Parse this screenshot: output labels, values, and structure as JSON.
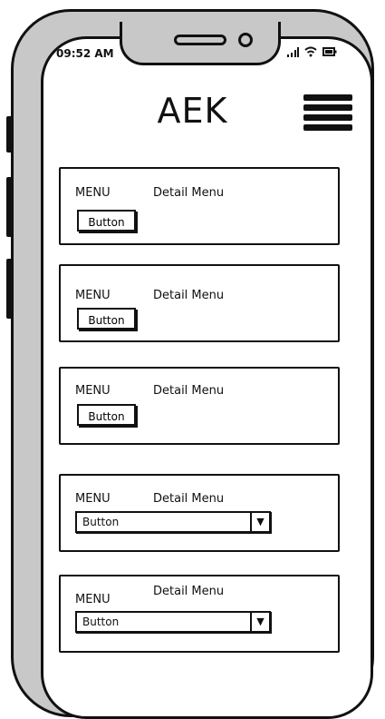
{
  "status_bar": {
    "time": "09:52 AM",
    "signal_icon": "signal-bars-icon",
    "wifi_icon": "wifi-icon",
    "battery_icon": "battery-icon"
  },
  "header": {
    "title": "AEK",
    "menu_icon": "hamburger-menu-icon"
  },
  "cards": [
    {
      "menu": "MENU",
      "detail": "Detail Menu",
      "control": "Button"
    },
    {
      "menu": "MENU",
      "detail": "Detail Menu",
      "control": "Button"
    },
    {
      "menu": "MENU",
      "detail": "Detail Menu",
      "control": "Button"
    },
    {
      "menu": "MENU",
      "detail": "Detail Menu",
      "control": "Button"
    },
    {
      "menu": "MENU",
      "detail": "Detail Menu",
      "control": "Button"
    }
  ]
}
